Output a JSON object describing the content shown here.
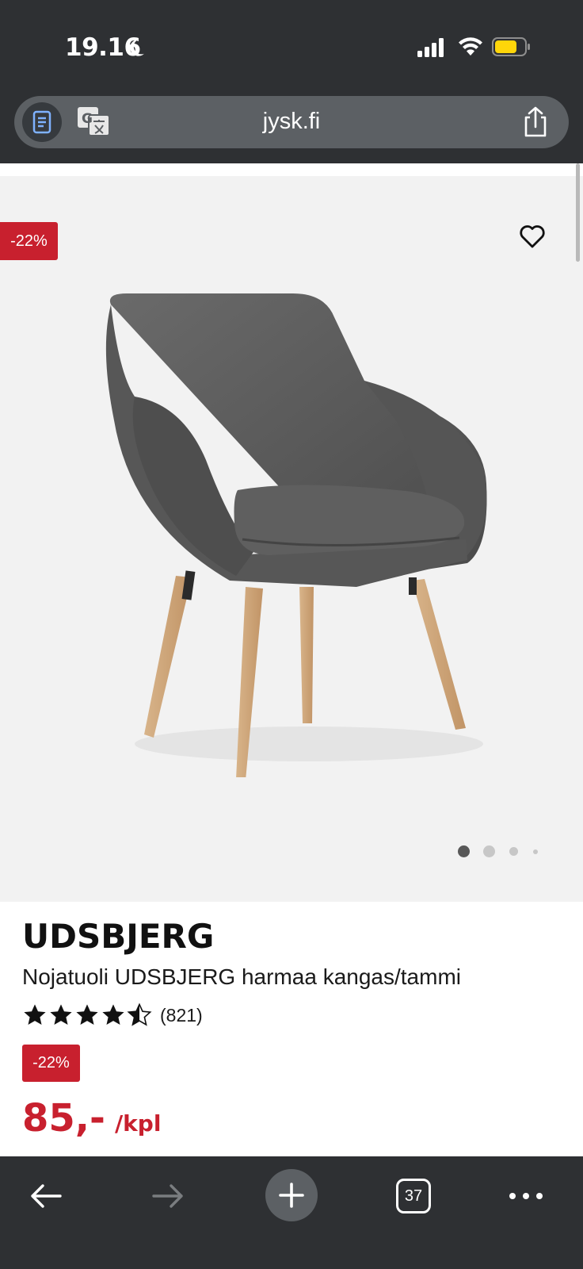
{
  "status_bar": {
    "time": "19.16"
  },
  "browser": {
    "url": "jysk.fi",
    "tab_count": "37"
  },
  "gallery": {
    "discount_badge": "-22%",
    "active_image_index": 1,
    "image_count": 4
  },
  "product": {
    "brand": "UDSBJERG",
    "name": "Nojatuoli UDSBJERG harmaa kangas/tammi",
    "rating": 4.5,
    "rating_count": "(821)",
    "discount_badge": "-22%",
    "price": "85,-",
    "unit": "/kpl"
  },
  "colors": {
    "accent_red": "#c8202e",
    "chrome_dark": "#2e3033",
    "gallery_bg": "#f2f2f2"
  },
  "icons": [
    "moon-icon",
    "cellular-signal-icon",
    "wifi-icon",
    "battery-icon",
    "reader-icon",
    "translate-icon",
    "share-icon",
    "heart-icon",
    "star-icon",
    "back-arrow-icon",
    "forward-arrow-icon",
    "plus-icon",
    "more-icon"
  ]
}
